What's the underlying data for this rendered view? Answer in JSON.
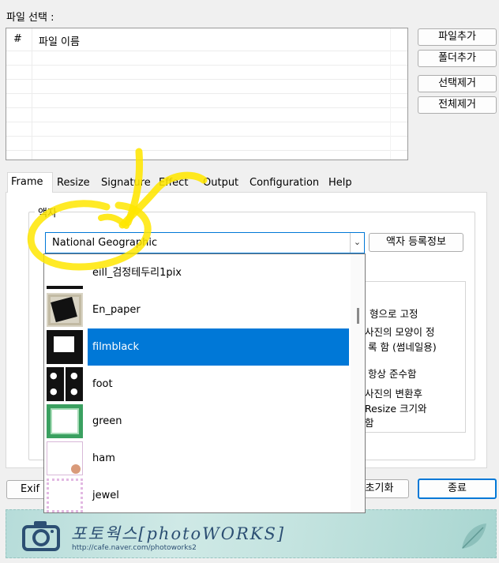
{
  "file_section": {
    "label": "파일 선택 :",
    "columns": [
      "#",
      "파일 이름"
    ],
    "rows": []
  },
  "side_buttons": {
    "add_file": "파일추가",
    "add_folder": "폴더추가",
    "remove_selected": "선택제거",
    "remove_all": "전체제거"
  },
  "tabs": [
    "Frame",
    "Resize",
    "Signature",
    "Effect",
    "Output",
    "Configuration",
    "Help"
  ],
  "active_tab": "Frame",
  "frame_panel": {
    "group_label": "액자",
    "combo_value": "National Geographic",
    "register_button": "액자 등록정보",
    "side_texts": [
      "형으로 고정",
      "사진의 모양이 정",
      "록 함 (썸네일용)",
      "항상 준수함",
      "사진의 변환후",
      "Resize 크기와",
      "함"
    ]
  },
  "dropdown_items": [
    {
      "label": "eill_검정테두리1pix",
      "thumb": "black-line-frame-thumb"
    },
    {
      "label": "En_paper",
      "thumb": "paper-frame-thumb"
    },
    {
      "label": "filmblack",
      "thumb": "film-black-frame-thumb",
      "selected": true
    },
    {
      "label": "foot",
      "thumb": "paw-print-frame-thumb"
    },
    {
      "label": "green",
      "thumb": "green-frame-thumb"
    },
    {
      "label": "ham",
      "thumb": "ham-frame-thumb"
    },
    {
      "label": "jewel",
      "thumb": "jewel-frame-thumb"
    }
  ],
  "bottom_buttons": {
    "exif": "Exif",
    "reset": "초기화",
    "exit": "종료"
  },
  "banner": {
    "title": "포토웍스[photoWORKS]",
    "url": "http://cafe.naver.com/photoworks2"
  },
  "colors": {
    "selection": "#0078d7",
    "annotation": "#ffe600",
    "banner": "#c3e3df"
  }
}
